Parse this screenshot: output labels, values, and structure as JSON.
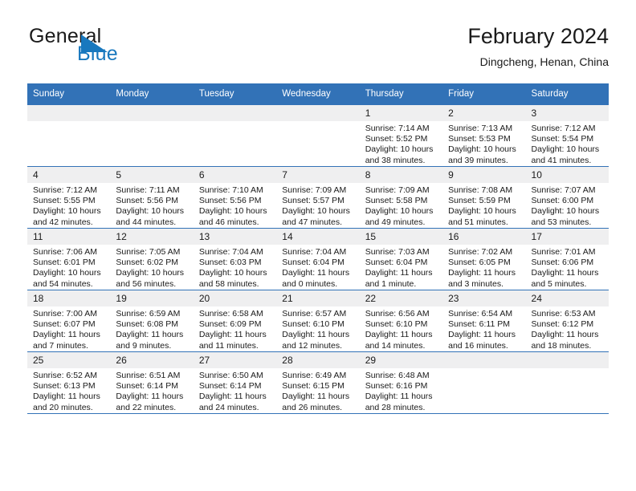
{
  "brand": {
    "name_part1": "General",
    "name_part2": "Blue",
    "triangle_color": "#1878be",
    "icon": "blue-triangle-logo"
  },
  "header": {
    "title": "February 2024",
    "subtitle": "Dingcheng, Henan, China"
  },
  "colors": {
    "header_blue": "#3272b7",
    "daynum_band": "#efeff0",
    "text": "#1a1a1a",
    "brand_blue": "#1878be"
  },
  "weekday_headers": [
    "Sunday",
    "Monday",
    "Tuesday",
    "Wednesday",
    "Thursday",
    "Friday",
    "Saturday"
  ],
  "weeks": [
    [
      {
        "day": "",
        "sunrise": "",
        "sunset": "",
        "daylight_line1": "",
        "daylight_line2": "",
        "empty": true
      },
      {
        "day": "",
        "sunrise": "",
        "sunset": "",
        "daylight_line1": "",
        "daylight_line2": "",
        "empty": true
      },
      {
        "day": "",
        "sunrise": "",
        "sunset": "",
        "daylight_line1": "",
        "daylight_line2": "",
        "empty": true
      },
      {
        "day": "",
        "sunrise": "",
        "sunset": "",
        "daylight_line1": "",
        "daylight_line2": "",
        "empty": true
      },
      {
        "day": "1",
        "sunrise": "Sunrise: 7:14 AM",
        "sunset": "Sunset: 5:52 PM",
        "daylight_line1": "Daylight: 10 hours",
        "daylight_line2": "and 38 minutes."
      },
      {
        "day": "2",
        "sunrise": "Sunrise: 7:13 AM",
        "sunset": "Sunset: 5:53 PM",
        "daylight_line1": "Daylight: 10 hours",
        "daylight_line2": "and 39 minutes."
      },
      {
        "day": "3",
        "sunrise": "Sunrise: 7:12 AM",
        "sunset": "Sunset: 5:54 PM",
        "daylight_line1": "Daylight: 10 hours",
        "daylight_line2": "and 41 minutes."
      }
    ],
    [
      {
        "day": "4",
        "sunrise": "Sunrise: 7:12 AM",
        "sunset": "Sunset: 5:55 PM",
        "daylight_line1": "Daylight: 10 hours",
        "daylight_line2": "and 42 minutes."
      },
      {
        "day": "5",
        "sunrise": "Sunrise: 7:11 AM",
        "sunset": "Sunset: 5:56 PM",
        "daylight_line1": "Daylight: 10 hours",
        "daylight_line2": "and 44 minutes."
      },
      {
        "day": "6",
        "sunrise": "Sunrise: 7:10 AM",
        "sunset": "Sunset: 5:56 PM",
        "daylight_line1": "Daylight: 10 hours",
        "daylight_line2": "and 46 minutes."
      },
      {
        "day": "7",
        "sunrise": "Sunrise: 7:09 AM",
        "sunset": "Sunset: 5:57 PM",
        "daylight_line1": "Daylight: 10 hours",
        "daylight_line2": "and 47 minutes."
      },
      {
        "day": "8",
        "sunrise": "Sunrise: 7:09 AM",
        "sunset": "Sunset: 5:58 PM",
        "daylight_line1": "Daylight: 10 hours",
        "daylight_line2": "and 49 minutes."
      },
      {
        "day": "9",
        "sunrise": "Sunrise: 7:08 AM",
        "sunset": "Sunset: 5:59 PM",
        "daylight_line1": "Daylight: 10 hours",
        "daylight_line2": "and 51 minutes."
      },
      {
        "day": "10",
        "sunrise": "Sunrise: 7:07 AM",
        "sunset": "Sunset: 6:00 PM",
        "daylight_line1": "Daylight: 10 hours",
        "daylight_line2": "and 53 minutes."
      }
    ],
    [
      {
        "day": "11",
        "sunrise": "Sunrise: 7:06 AM",
        "sunset": "Sunset: 6:01 PM",
        "daylight_line1": "Daylight: 10 hours",
        "daylight_line2": "and 54 minutes."
      },
      {
        "day": "12",
        "sunrise": "Sunrise: 7:05 AM",
        "sunset": "Sunset: 6:02 PM",
        "daylight_line1": "Daylight: 10 hours",
        "daylight_line2": "and 56 minutes."
      },
      {
        "day": "13",
        "sunrise": "Sunrise: 7:04 AM",
        "sunset": "Sunset: 6:03 PM",
        "daylight_line1": "Daylight: 10 hours",
        "daylight_line2": "and 58 minutes."
      },
      {
        "day": "14",
        "sunrise": "Sunrise: 7:04 AM",
        "sunset": "Sunset: 6:04 PM",
        "daylight_line1": "Daylight: 11 hours",
        "daylight_line2": "and 0 minutes."
      },
      {
        "day": "15",
        "sunrise": "Sunrise: 7:03 AM",
        "sunset": "Sunset: 6:04 PM",
        "daylight_line1": "Daylight: 11 hours",
        "daylight_line2": "and 1 minute."
      },
      {
        "day": "16",
        "sunrise": "Sunrise: 7:02 AM",
        "sunset": "Sunset: 6:05 PM",
        "daylight_line1": "Daylight: 11 hours",
        "daylight_line2": "and 3 minutes."
      },
      {
        "day": "17",
        "sunrise": "Sunrise: 7:01 AM",
        "sunset": "Sunset: 6:06 PM",
        "daylight_line1": "Daylight: 11 hours",
        "daylight_line2": "and 5 minutes."
      }
    ],
    [
      {
        "day": "18",
        "sunrise": "Sunrise: 7:00 AM",
        "sunset": "Sunset: 6:07 PM",
        "daylight_line1": "Daylight: 11 hours",
        "daylight_line2": "and 7 minutes."
      },
      {
        "day": "19",
        "sunrise": "Sunrise: 6:59 AM",
        "sunset": "Sunset: 6:08 PM",
        "daylight_line1": "Daylight: 11 hours",
        "daylight_line2": "and 9 minutes."
      },
      {
        "day": "20",
        "sunrise": "Sunrise: 6:58 AM",
        "sunset": "Sunset: 6:09 PM",
        "daylight_line1": "Daylight: 11 hours",
        "daylight_line2": "and 11 minutes."
      },
      {
        "day": "21",
        "sunrise": "Sunrise: 6:57 AM",
        "sunset": "Sunset: 6:10 PM",
        "daylight_line1": "Daylight: 11 hours",
        "daylight_line2": "and 12 minutes."
      },
      {
        "day": "22",
        "sunrise": "Sunrise: 6:56 AM",
        "sunset": "Sunset: 6:10 PM",
        "daylight_line1": "Daylight: 11 hours",
        "daylight_line2": "and 14 minutes."
      },
      {
        "day": "23",
        "sunrise": "Sunrise: 6:54 AM",
        "sunset": "Sunset: 6:11 PM",
        "daylight_line1": "Daylight: 11 hours",
        "daylight_line2": "and 16 minutes."
      },
      {
        "day": "24",
        "sunrise": "Sunrise: 6:53 AM",
        "sunset": "Sunset: 6:12 PM",
        "daylight_line1": "Daylight: 11 hours",
        "daylight_line2": "and 18 minutes."
      }
    ],
    [
      {
        "day": "25",
        "sunrise": "Sunrise: 6:52 AM",
        "sunset": "Sunset: 6:13 PM",
        "daylight_line1": "Daylight: 11 hours",
        "daylight_line2": "and 20 minutes."
      },
      {
        "day": "26",
        "sunrise": "Sunrise: 6:51 AM",
        "sunset": "Sunset: 6:14 PM",
        "daylight_line1": "Daylight: 11 hours",
        "daylight_line2": "and 22 minutes."
      },
      {
        "day": "27",
        "sunrise": "Sunrise: 6:50 AM",
        "sunset": "Sunset: 6:14 PM",
        "daylight_line1": "Daylight: 11 hours",
        "daylight_line2": "and 24 minutes."
      },
      {
        "day": "28",
        "sunrise": "Sunrise: 6:49 AM",
        "sunset": "Sunset: 6:15 PM",
        "daylight_line1": "Daylight: 11 hours",
        "daylight_line2": "and 26 minutes."
      },
      {
        "day": "29",
        "sunrise": "Sunrise: 6:48 AM",
        "sunset": "Sunset: 6:16 PM",
        "daylight_line1": "Daylight: 11 hours",
        "daylight_line2": "and 28 minutes."
      },
      {
        "day": "",
        "sunrise": "",
        "sunset": "",
        "daylight_line1": "",
        "daylight_line2": "",
        "empty": true
      },
      {
        "day": "",
        "sunrise": "",
        "sunset": "",
        "daylight_line1": "",
        "daylight_line2": "",
        "empty": true
      }
    ]
  ]
}
